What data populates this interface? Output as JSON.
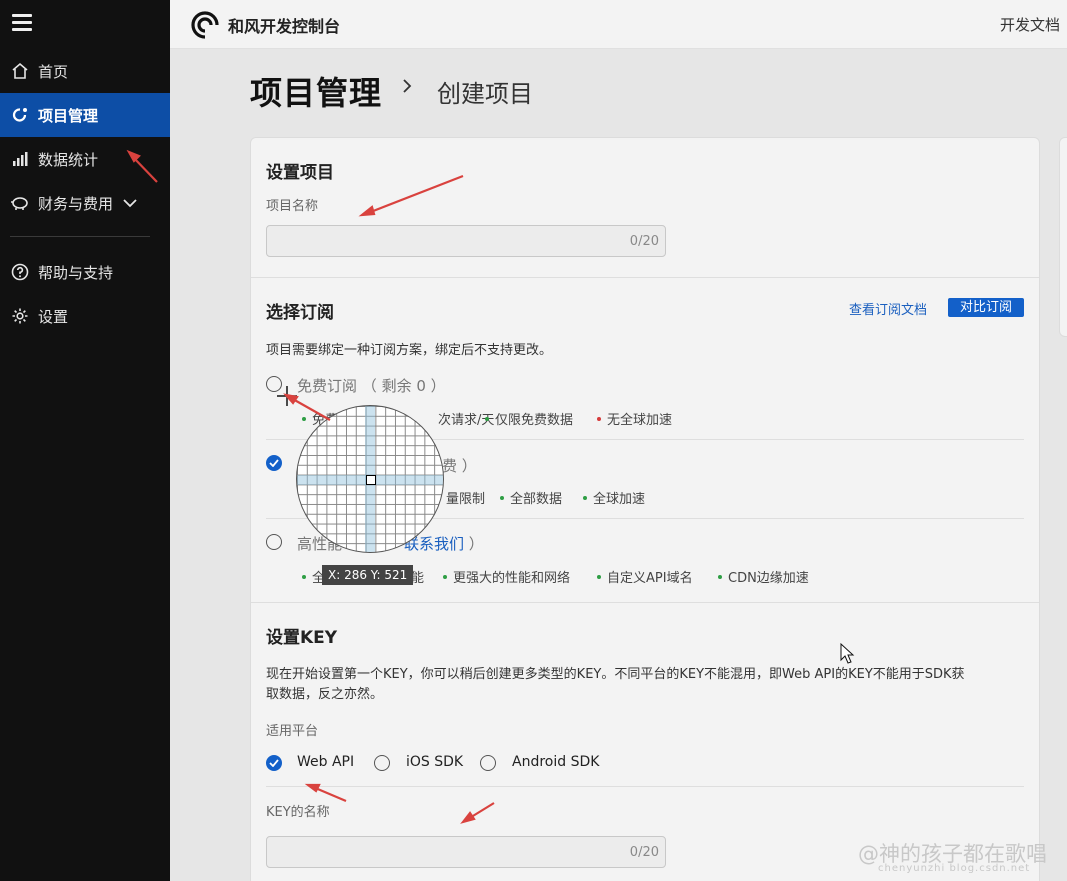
{
  "sidebar": {
    "items": [
      {
        "label": "首页",
        "icon": "home-icon"
      },
      {
        "label": "项目管理",
        "icon": "project-icon",
        "active": true
      },
      {
        "label": "数据统计",
        "icon": "bar-chart-icon"
      },
      {
        "label": "财务与费用",
        "icon": "piggy-bank-icon",
        "expandable": true
      },
      {
        "label": "帮助与支持",
        "icon": "help-icon"
      },
      {
        "label": "设置",
        "icon": "gear-icon"
      }
    ]
  },
  "topbar": {
    "brand": "和风开发控制台",
    "docs_link": "开发文档"
  },
  "header": {
    "title": "项目管理",
    "current": "创建项目"
  },
  "setup_project": {
    "title": "设置项目",
    "name_label": "项目名称",
    "name_value": "",
    "name_counter": "0/20"
  },
  "subscription": {
    "title": "选择订阅",
    "docs_link": "查看订阅文档",
    "compare_button": "对比订阅",
    "description": "项目需要绑定一种订阅方案，绑定后不支持更改。",
    "options": [
      {
        "title": "免费订阅",
        "note": "（ 剩余 0 ）",
        "selected": false,
        "features": [
          {
            "text": "免费",
            "status": "ok"
          },
          {
            "text": "次请求/天",
            "status": "ok"
          },
          {
            "text": "仅限免费数据",
            "status": "ok"
          },
          {
            "text": "无全球加速",
            "status": "no"
          }
        ]
      },
      {
        "title": "",
        "note": "费 ）",
        "selected": true,
        "features": [
          {
            "text": "量限制",
            "status": "ok"
          },
          {
            "text": "全部数据",
            "status": "ok"
          },
          {
            "text": "全球加速",
            "status": "ok"
          }
        ]
      },
      {
        "title": "高性能",
        "note_link": "联系我们",
        "note_close": "）",
        "selected": false,
        "features": [
          {
            "text": "全",
            "status": "ok"
          },
          {
            "text": "能",
            "status": "ok"
          },
          {
            "text": "更强大的性能和网络",
            "status": "ok"
          },
          {
            "text": "自定义API域名",
            "status": "ok"
          },
          {
            "text": "CDN边缘加速",
            "status": "ok"
          }
        ]
      }
    ]
  },
  "setup_key": {
    "title": "设置KEY",
    "description_line1": "现在开始设置第一个KEY，你可以稍后创建更多类型的KEY。不同平台的KEY不能混用，即Web API的KEY不能用于SDK获",
    "description_line2": "取数据，反之亦然。",
    "platform_label": "适用平台",
    "platforms": [
      {
        "label": "Web API",
        "selected": true
      },
      {
        "label": "iOS SDK",
        "selected": false
      },
      {
        "label": "Android SDK",
        "selected": false
      }
    ],
    "key_name_label": "KEY的名称",
    "key_name_value": "",
    "key_name_counter": "0/20"
  },
  "overlay": {
    "coordinates": "X: 286 Y: 521"
  },
  "watermark": {
    "main": "@神的孩子都在歌唱",
    "sub": "chenyunzhi blog.csdn.net"
  },
  "colors": {
    "sidebar_bg": "#111111",
    "active_bg": "#0d4ea6",
    "accent": "#1360c9",
    "annotation_arrow": "#d9423e",
    "ok_dot": "#2e9e44",
    "no_dot": "#d63b3b"
  }
}
